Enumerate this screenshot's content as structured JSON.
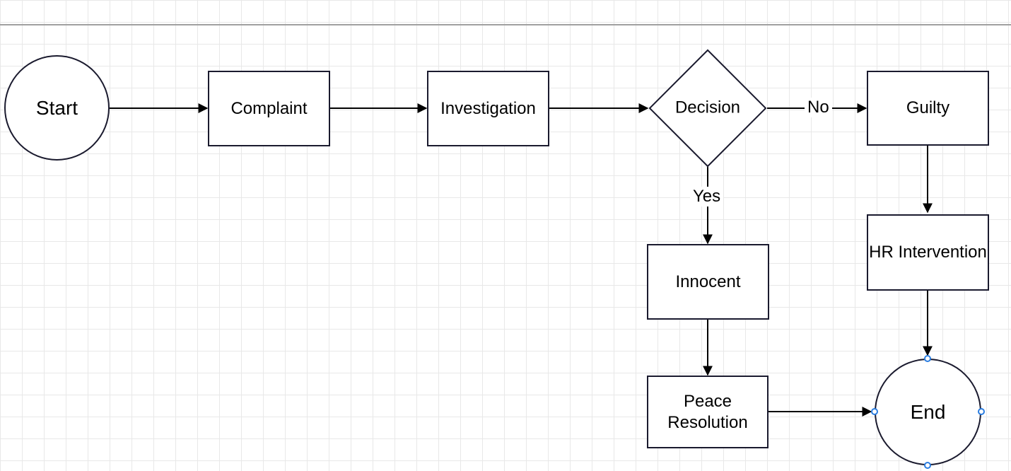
{
  "nodes": {
    "start": {
      "label": "Start"
    },
    "complaint": {
      "label": "Complaint"
    },
    "investigation": {
      "label": "Investigation"
    },
    "decision": {
      "label": "Decision"
    },
    "guilty": {
      "label": "Guilty"
    },
    "innocent": {
      "label": "Innocent"
    },
    "hr_intervention": {
      "label": "HR Intervention"
    },
    "peace_resolution": {
      "label": "Peace Resolution"
    },
    "end": {
      "label": "End"
    }
  },
  "edge_labels": {
    "decision_no": "No",
    "decision_yes": "Yes"
  },
  "selected_node": "end"
}
